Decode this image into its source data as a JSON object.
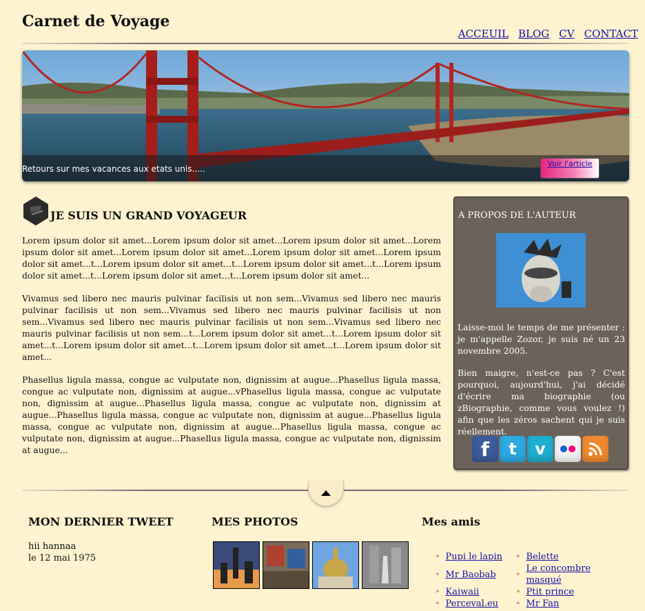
{
  "header": {
    "title": "Carnet de Voyage"
  },
  "nav": {
    "items": [
      "ACCEUIL",
      "BLOG",
      "CV",
      "CONTACT"
    ]
  },
  "banner": {
    "caption": "Retours sur mes vacances aux etats unis.....",
    "button": "Voir l'article"
  },
  "article": {
    "title": "JE SUIS UN GRAND VOYAGEUR",
    "paragraphs": [
      "Lorem ipsum dolor sit amet...Lorem ipsum dolor sit amet...Lorem ipsum dolor sit amet...Lorem ipsum dolor sit amet...Lorem ipsum dolor sit amet...Lorem ipsum dolor sit amet...Lorem ipsum dolor sit amet...t...Lorem ipsum dolor sit amet...t...Lorem ipsum dolor sit amet...t...Lorem ipsum dolor sit amet...t...Lorem ipsum dolor sit amet...t...Lorem ipsum dolor sit amet...",
      "Vivamus sed libero nec mauris pulvinar facilisis ut non sem...Vivamus sed libero nec mauris pulvinar facilisis ut non sem...Vivamus sed libero nec mauris pulvinar facilisis ut non sem...Vivamus sed libero nec mauris pulvinar facilisis ut non sem...Vivamus sed libero nec mauris pulvinar facilisis ut non sem...t...Lorem ipsum dolor sit amet...t...Lorem ipsum dolor sit amet...t...Lorem ipsum dolor sit amet...t...Lorem ipsum dolor sit amet...t...Lorem ipsum dolor sit amet...",
      "Phasellus ligula massa, congue ac vulputate non, dignissim at augue...Phasellus ligula massa, congue ac vulputate non, dignissim at augue...vPhasellus ligula massa, congue ac vulputate non, dignissim at augue...Phasellus ligula massa, congue ac vulputate non, dignissim at augue...Phasellus ligula massa, congue ac vulputate non, dignissim at augue...Phasellus ligula massa, congue ac vulputate non, dignissim at augue...Phasellus ligula massa, congue ac vulputate non, dignissim at augue...Phasellus ligula massa, congue ac vulputate non, dignissim at augue..."
    ]
  },
  "about": {
    "title": "A PROPOS DE L'AUTEUR",
    "paragraphs": [
      "Laisse-moi le temps de me présenter : je m'appelle Zozor, je suis né un 23 novembre 2005.",
      "Bien maigre, n'est-ce pas ? C'est pourquoi, aujourd'hui, j'ai décidé d'écrire ma biographie (ou zBiographie, comme vous voulez !) afin que les zéros sachent qui je suis réellement."
    ],
    "socials": [
      {
        "name": "facebook-icon",
        "glyph": "f"
      },
      {
        "name": "twitter-icon",
        "glyph": "t"
      },
      {
        "name": "vimeo-icon",
        "glyph": "v"
      },
      {
        "name": "flickr-icon",
        "glyph": ""
      },
      {
        "name": "rss-icon",
        "glyph": ""
      }
    ]
  },
  "footer": {
    "tweet_title": "MON DERNIER TWEET",
    "tweet_text": "hii hannaa",
    "tweet_date": "le 12 mai 1975",
    "photos_title": "MES PHOTOS",
    "friends_title": "Mes amis",
    "friends": [
      "Pupi le lapin",
      "Belette",
      "Mr Baobab",
      "Le concombre masqué",
      "Kaiwaii",
      "Ptit prince",
      "Perceval.eu",
      "Mr Fan"
    ]
  },
  "colors": {
    "background": "#fdf3cf",
    "about_bg": "#6b625a",
    "link": "#1a0dab",
    "bullet": "#bb2222"
  }
}
